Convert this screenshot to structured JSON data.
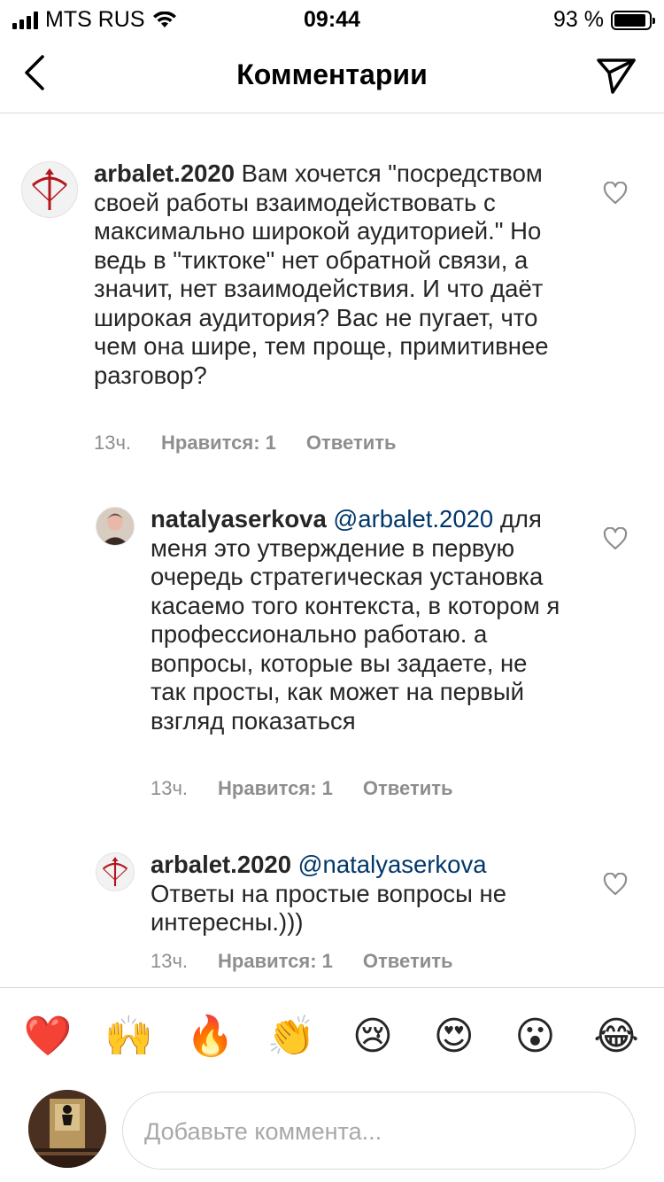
{
  "status_bar": {
    "carrier": "MTS RUS",
    "time": "09:44",
    "battery_text": "93 %",
    "battery_level": 0.93
  },
  "header": {
    "title": "Комментарии",
    "back_icon": "chevron-left-icon",
    "send_icon": "paper-plane-icon"
  },
  "comments": [
    {
      "username": "arbalet.2020",
      "mention": "",
      "text": " Вам хочется \"посредством своей работы взаимодействовать с максимально широкой аудиторией.\" Но ведь в \"тиктоке\" нет обратной связи, а значит, нет взаимодействия. И что даёт широкая аудитория? Вас не пугает, что чем она шире, тем проще, примитивнее разговор?",
      "time": "13ч.",
      "likes": "Нравится: 1",
      "reply": "Ответить"
    },
    {
      "username": "natalyaserkova",
      "mention": " @arbalet.2020",
      "text": " для меня это утверждение в первую очередь стратегическая установка касаемо того контекста, в котором я профессионально работаю. а вопросы, которые вы задаете, не так просты, как может на первый взгляд показаться",
      "time": "13ч.",
      "likes": "Нравится: 1",
      "reply": "Ответить"
    },
    {
      "username": "arbalet.2020",
      "mention": " @natalyaserkova",
      "text": " Ответы на простые вопросы не интересны.)))",
      "time": "13ч.",
      "likes": "Нравится: 1",
      "reply": "Ответить"
    }
  ],
  "emojis": [
    "❤️",
    "🙌",
    "🔥",
    "👏",
    "😢",
    "😍",
    "😮",
    "😂"
  ],
  "composer": {
    "placeholder": "Добавьте коммента..."
  },
  "colors": {
    "mention": "#00376b",
    "meta": "#8e8e8e",
    "divider": "#dbdbdb"
  }
}
